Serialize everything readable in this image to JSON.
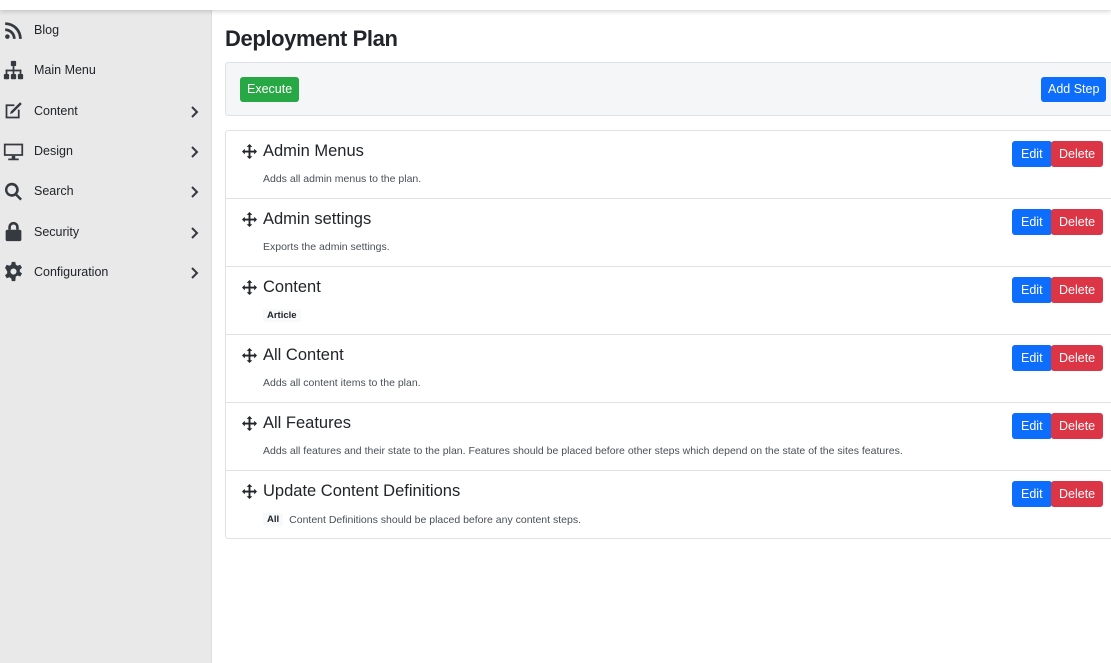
{
  "sidebar": {
    "items": [
      {
        "label": "Blog",
        "icon": "rss-icon",
        "has_submenu": false
      },
      {
        "label": "Main Menu",
        "icon": "sitemap-icon",
        "has_submenu": false
      },
      {
        "label": "Content",
        "icon": "edit-icon",
        "has_submenu": true
      },
      {
        "label": "Design",
        "icon": "desktop-icon",
        "has_submenu": true
      },
      {
        "label": "Search",
        "icon": "search-icon",
        "has_submenu": true
      },
      {
        "label": "Security",
        "icon": "lock-icon",
        "has_submenu": true
      },
      {
        "label": "Configuration",
        "icon": "gear-icon",
        "has_submenu": true
      }
    ]
  },
  "page": {
    "title": "Deployment Plan"
  },
  "toolbar": {
    "execute_label": "Execute",
    "add_step_label": "Add Step"
  },
  "steps": [
    {
      "title": "Admin Menus",
      "badge": "",
      "description": "Adds all admin menus to the plan.",
      "edit_label": "Edit",
      "delete_label": "Delete"
    },
    {
      "title": "Admin settings",
      "badge": "",
      "description": "Exports the admin settings.",
      "edit_label": "Edit",
      "delete_label": "Delete"
    },
    {
      "title": "Content",
      "badge": "Article",
      "description": "",
      "edit_label": "Edit",
      "delete_label": "Delete"
    },
    {
      "title": "All Content",
      "badge": "",
      "description": "Adds all content items to the plan.",
      "edit_label": "Edit",
      "delete_label": "Delete"
    },
    {
      "title": "All Features",
      "badge": "",
      "description": "Adds all features and their state to the plan. Features should be placed before other steps which depend on the state of the sites features.",
      "edit_label": "Edit",
      "delete_label": "Delete"
    },
    {
      "title": "Update Content Definitions",
      "badge": "All",
      "description": "Content Definitions should be placed before any content steps.",
      "edit_label": "Edit",
      "delete_label": "Delete"
    }
  ],
  "colors": {
    "primary": "#0d6efd",
    "success": "#28a745",
    "danger": "#dc3545",
    "sidebar_bg": "#e9e9e9"
  }
}
